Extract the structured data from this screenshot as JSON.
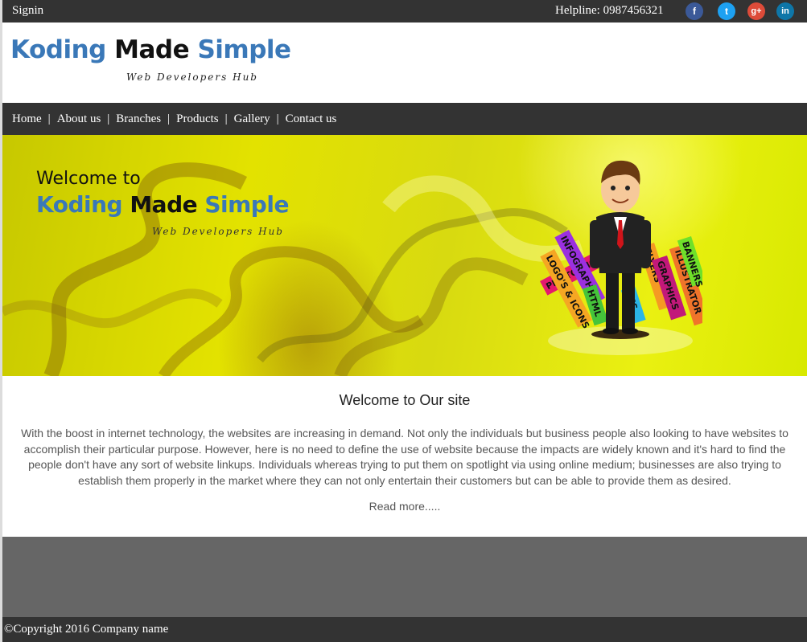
{
  "topbar": {
    "signin": "Signin",
    "helpline": "Helpline: 0987456321",
    "social": [
      {
        "icon": "facebook-icon",
        "glyph": "f",
        "color": "#3b5998"
      },
      {
        "icon": "twitter-icon",
        "glyph": "t",
        "color": "#1da1f2"
      },
      {
        "icon": "google-plus-icon",
        "glyph": "g+",
        "color": "#dd4b39"
      },
      {
        "icon": "linkedin-icon",
        "glyph": "in",
        "color": "#0e76a8"
      }
    ]
  },
  "header": {
    "logo_word1": "Koding",
    "logo_word2": "Made",
    "logo_word3": "Simple",
    "tagline": "Web Developers Hub"
  },
  "nav": {
    "items": [
      "Home",
      "About us",
      "Branches",
      "Products",
      "Gallery",
      "Contact us"
    ],
    "separator": "|"
  },
  "banner": {
    "welcome": "Welcome to",
    "title_word1": "Koding",
    "title_word2": "Made",
    "title_word3": "Simple",
    "tagline": "Web Developers Hub",
    "illustration_labels": [
      "PHOTOSHOP",
      "LOGO'S & ICONS",
      "INFOGRAPHIC",
      "HTML",
      "CSS",
      "FLYERS",
      "GRAPHICS",
      "ILLUSTRATOR",
      "BANNERS"
    ]
  },
  "main": {
    "heading": "Welcome to Our site",
    "body": "With the boost in internet technology, the websites are increasing in demand. Not only the individuals but business people also looking to have websites to accomplish their particular purpose. However, here is no need to define the use of website because the impacts are widely known and it's hard to find the people don't have any sort of website linkups. Individuals whereas trying to put them on spotlight via using online medium; businesses are also trying to establish them properly in the market where they can not only entertain their customers but can be able to provide them as desired.",
    "read_more": "Read more....."
  },
  "footer": {
    "copyright": "©Copyright 2016 Company name"
  },
  "colors": {
    "bar": "#333333",
    "brand_blue": "#3a78b8",
    "footer_gray": "#666666"
  }
}
